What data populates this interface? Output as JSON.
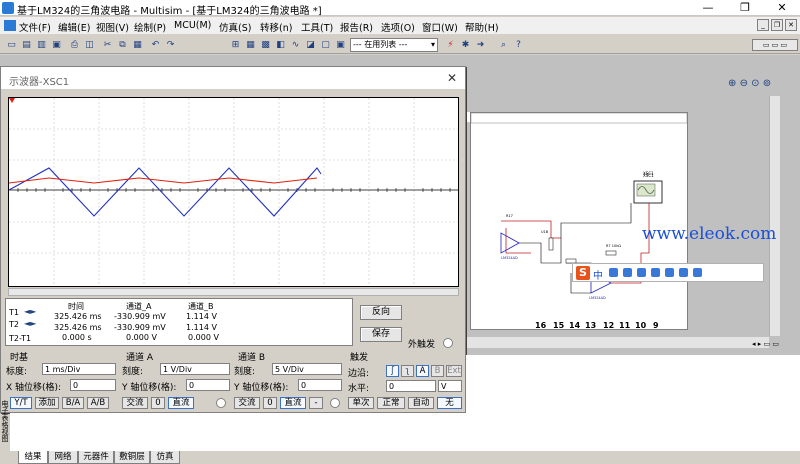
{
  "window": {
    "title": "基于LM324的三角波电路 - Multisim - [基于LM324的三角波电路 *]",
    "controls": [
      "—",
      "❐",
      "✕"
    ]
  },
  "menu": [
    "文件(F)",
    "编辑(E)",
    "视图(V)",
    "绘制(P)",
    "MCU(M)",
    "仿真(S)",
    "转移(n)",
    "工具(T)",
    "报告(R)",
    "选项(O)",
    "窗口(W)",
    "帮助(H)"
  ],
  "toolbar": {
    "in_use_list": "--- 在用列表 ---"
  },
  "canvas": {
    "pin_numbers": [
      "16",
      "15",
      "14",
      "13",
      "12",
      "11",
      "10",
      "9"
    ],
    "instrument_label": "XSC1",
    "watermark": "www.eleok.com"
  },
  "ime": {
    "mode": "中"
  },
  "oscilloscope": {
    "title": "示波器-XSC1",
    "close": "✕",
    "readout": {
      "headers": [
        "时间",
        "通道_A",
        "通道_B"
      ],
      "rows": [
        {
          "label": "T1",
          "time": "325.426 ms",
          "a": "-330.909 mV",
          "b": "1.114 V"
        },
        {
          "label": "T2",
          "time": "325.426 ms",
          "a": "-330.909 mV",
          "b": "1.114 V"
        },
        {
          "label": "T2-T1",
          "time": "0.000 s",
          "a": "0.000 V",
          "b": "0.000 V"
        }
      ]
    },
    "reverse_button": "反向",
    "save_button": "保存",
    "ext_trigger": "外触发",
    "timebase": {
      "title": "时基",
      "scale_label": "标度:",
      "scale_value": "1 ms/Div",
      "xpos_label": "X 轴位移(格):",
      "xpos_value": "0",
      "modes": [
        "Y/T",
        "添加",
        "B/A",
        "A/B"
      ]
    },
    "channel_a": {
      "title": "通道 A",
      "scale_label": "刻度:",
      "scale_value": "1 V/Div",
      "ypos_label": "Y 轴位移(格):",
      "ypos_value": "0",
      "coupling": [
        "交流",
        "0",
        "直流"
      ]
    },
    "channel_b": {
      "title": "通道 B",
      "scale_label": "刻度:",
      "scale_value": "5 V/Div",
      "ypos_label": "Y 轴位移(格):",
      "ypos_value": "0",
      "coupling": [
        "交流",
        "0",
        "直流",
        "-"
      ]
    },
    "trigger": {
      "title": "触发",
      "edge_label": "边沿:",
      "edge_options": [
        "A",
        "B",
        "Ext"
      ],
      "level_label": "水平:",
      "level_value": "0",
      "level_unit": "V",
      "modes": [
        "单次",
        "正常",
        "自动",
        "无"
      ]
    },
    "colors": {
      "channel_a": "#e02010",
      "channel_b": "#2030c0"
    }
  },
  "bottom_tabs": [
    "结果",
    "网络",
    "元器件",
    "敷铜层",
    "仿真"
  ],
  "side_panel_label": "电子表格视图"
}
